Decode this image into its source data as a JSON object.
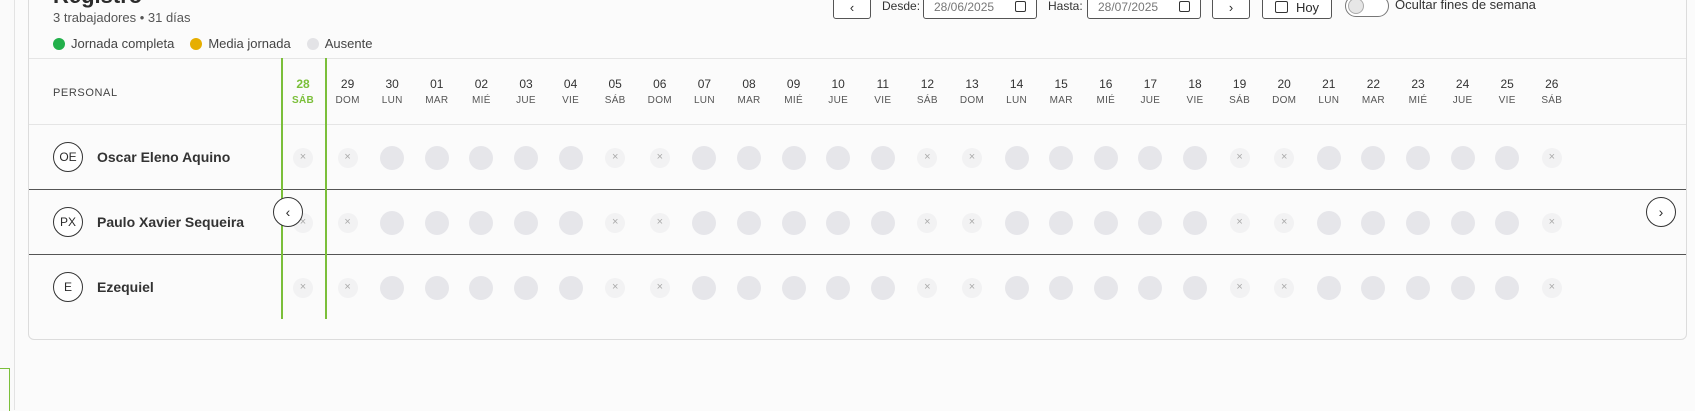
{
  "header": {
    "title": "Registro",
    "subtitle": "3 trabajadores • 31 días",
    "legend": [
      {
        "label": "Jornada completa",
        "color": "#22b04b"
      },
      {
        "label": "Media jornada",
        "color": "#e6ae00"
      },
      {
        "label": "Ausente",
        "color": "#e3e3e6"
      }
    ]
  },
  "toolbar": {
    "prev": "‹",
    "from_label": "Desde:",
    "from_value": "28/06/2025",
    "to_label": "Hasta:",
    "to_value": "28/07/2025",
    "next": "›",
    "today_label": "Hoy",
    "hide_weekends_label": "Ocultar fines de semana"
  },
  "grid": {
    "personal_header": "PERSONAL",
    "days": [
      {
        "num": "28",
        "name": "SÁB",
        "weekend": true,
        "today": true
      },
      {
        "num": "29",
        "name": "DOM",
        "weekend": true
      },
      {
        "num": "30",
        "name": "LUN"
      },
      {
        "num": "01",
        "name": "MAR"
      },
      {
        "num": "02",
        "name": "MIÉ"
      },
      {
        "num": "03",
        "name": "JUE"
      },
      {
        "num": "04",
        "name": "VIE"
      },
      {
        "num": "05",
        "name": "SÁB",
        "weekend": true
      },
      {
        "num": "06",
        "name": "DOM",
        "weekend": true
      },
      {
        "num": "07",
        "name": "LUN"
      },
      {
        "num": "08",
        "name": "MAR"
      },
      {
        "num": "09",
        "name": "MIÉ"
      },
      {
        "num": "10",
        "name": "JUE"
      },
      {
        "num": "11",
        "name": "VIE"
      },
      {
        "num": "12",
        "name": "SÁB",
        "weekend": true
      },
      {
        "num": "13",
        "name": "DOM",
        "weekend": true
      },
      {
        "num": "14",
        "name": "LUN"
      },
      {
        "num": "15",
        "name": "MAR"
      },
      {
        "num": "16",
        "name": "MIÉ"
      },
      {
        "num": "17",
        "name": "JUE"
      },
      {
        "num": "18",
        "name": "VIE"
      },
      {
        "num": "19",
        "name": "SÁB",
        "weekend": true
      },
      {
        "num": "20",
        "name": "DOM",
        "weekend": true
      },
      {
        "num": "21",
        "name": "LUN"
      },
      {
        "num": "22",
        "name": "MAR"
      },
      {
        "num": "23",
        "name": "MIÉ"
      },
      {
        "num": "24",
        "name": "JUE"
      },
      {
        "num": "25",
        "name": "VIE"
      },
      {
        "num": "26",
        "name": "SÁB",
        "weekend": true
      }
    ],
    "people": [
      {
        "initials": "OE",
        "name": "Oscar Eleno Aquino"
      },
      {
        "initials": "PX",
        "name": "Paulo Xavier Sequeira"
      },
      {
        "initials": "E",
        "name": "Ezequiel"
      }
    ],
    "scroll_left": "‹",
    "scroll_right": "›"
  }
}
